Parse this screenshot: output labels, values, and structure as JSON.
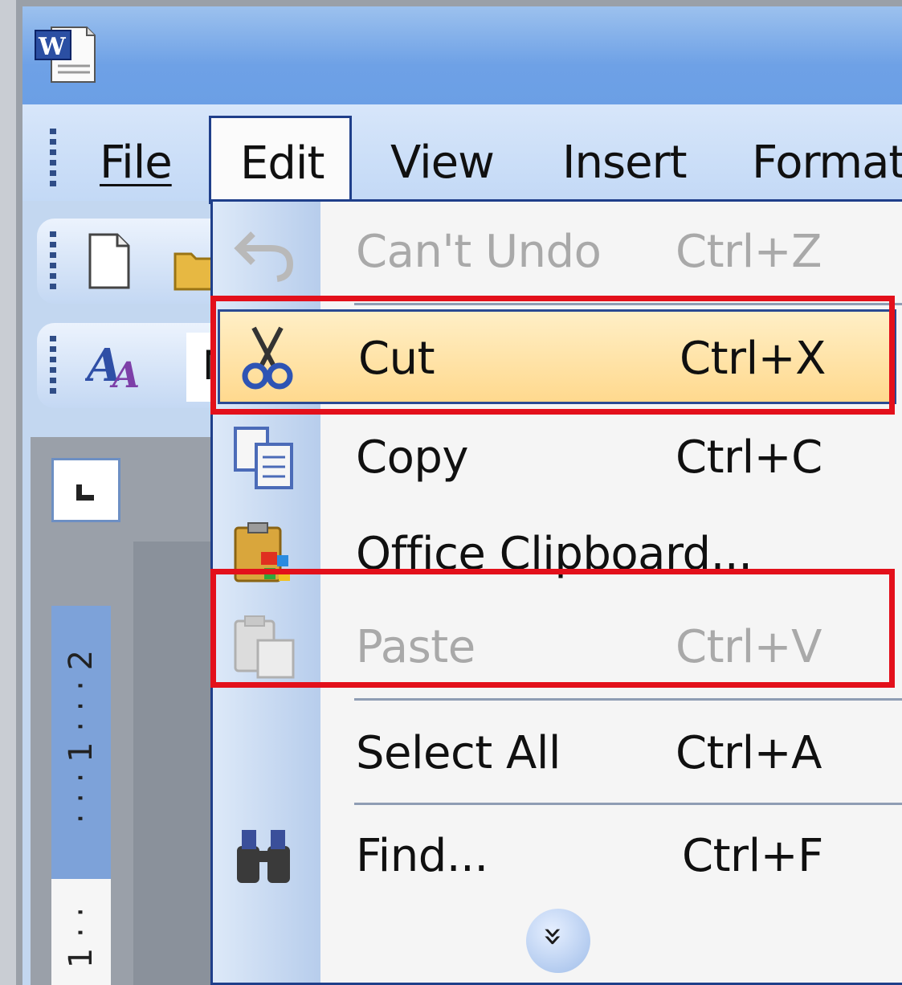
{
  "menubar": {
    "items": [
      {
        "label": "File"
      },
      {
        "label": "Edit",
        "active": true
      },
      {
        "label": "View"
      },
      {
        "label": "Insert"
      },
      {
        "label": "Format"
      }
    ]
  },
  "toolbar": {
    "font_box_text": "N"
  },
  "ruler": {
    "labels_blue": "· · · 1 · · · 2",
    "labels_white": "1 · ·"
  },
  "edit_menu": {
    "items": [
      {
        "label": "Can't Undo",
        "shortcut": "Ctrl+Z",
        "icon": "undo-icon",
        "disabled": true
      },
      {
        "label": "Cut",
        "shortcut": "Ctrl+X",
        "icon": "scissors-icon",
        "hover": true
      },
      {
        "label": "Copy",
        "shortcut": "Ctrl+C",
        "icon": "copy-icon"
      },
      {
        "label": "Office Clipboard...",
        "shortcut": "",
        "icon": "clipboard-icon"
      },
      {
        "label": "Paste",
        "shortcut": "Ctrl+V",
        "icon": "paste-icon",
        "disabled": true
      },
      {
        "label": "Select All",
        "shortcut": "Ctrl+A",
        "icon": ""
      },
      {
        "label": "Find...",
        "shortcut": "Ctrl+F",
        "icon": "binoculars-icon"
      }
    ],
    "expand_glyph": "»"
  },
  "colors": {
    "highlight_red": "#e3101b",
    "hover_bg": "#ffd98e",
    "menu_border": "#1f3f8a"
  }
}
